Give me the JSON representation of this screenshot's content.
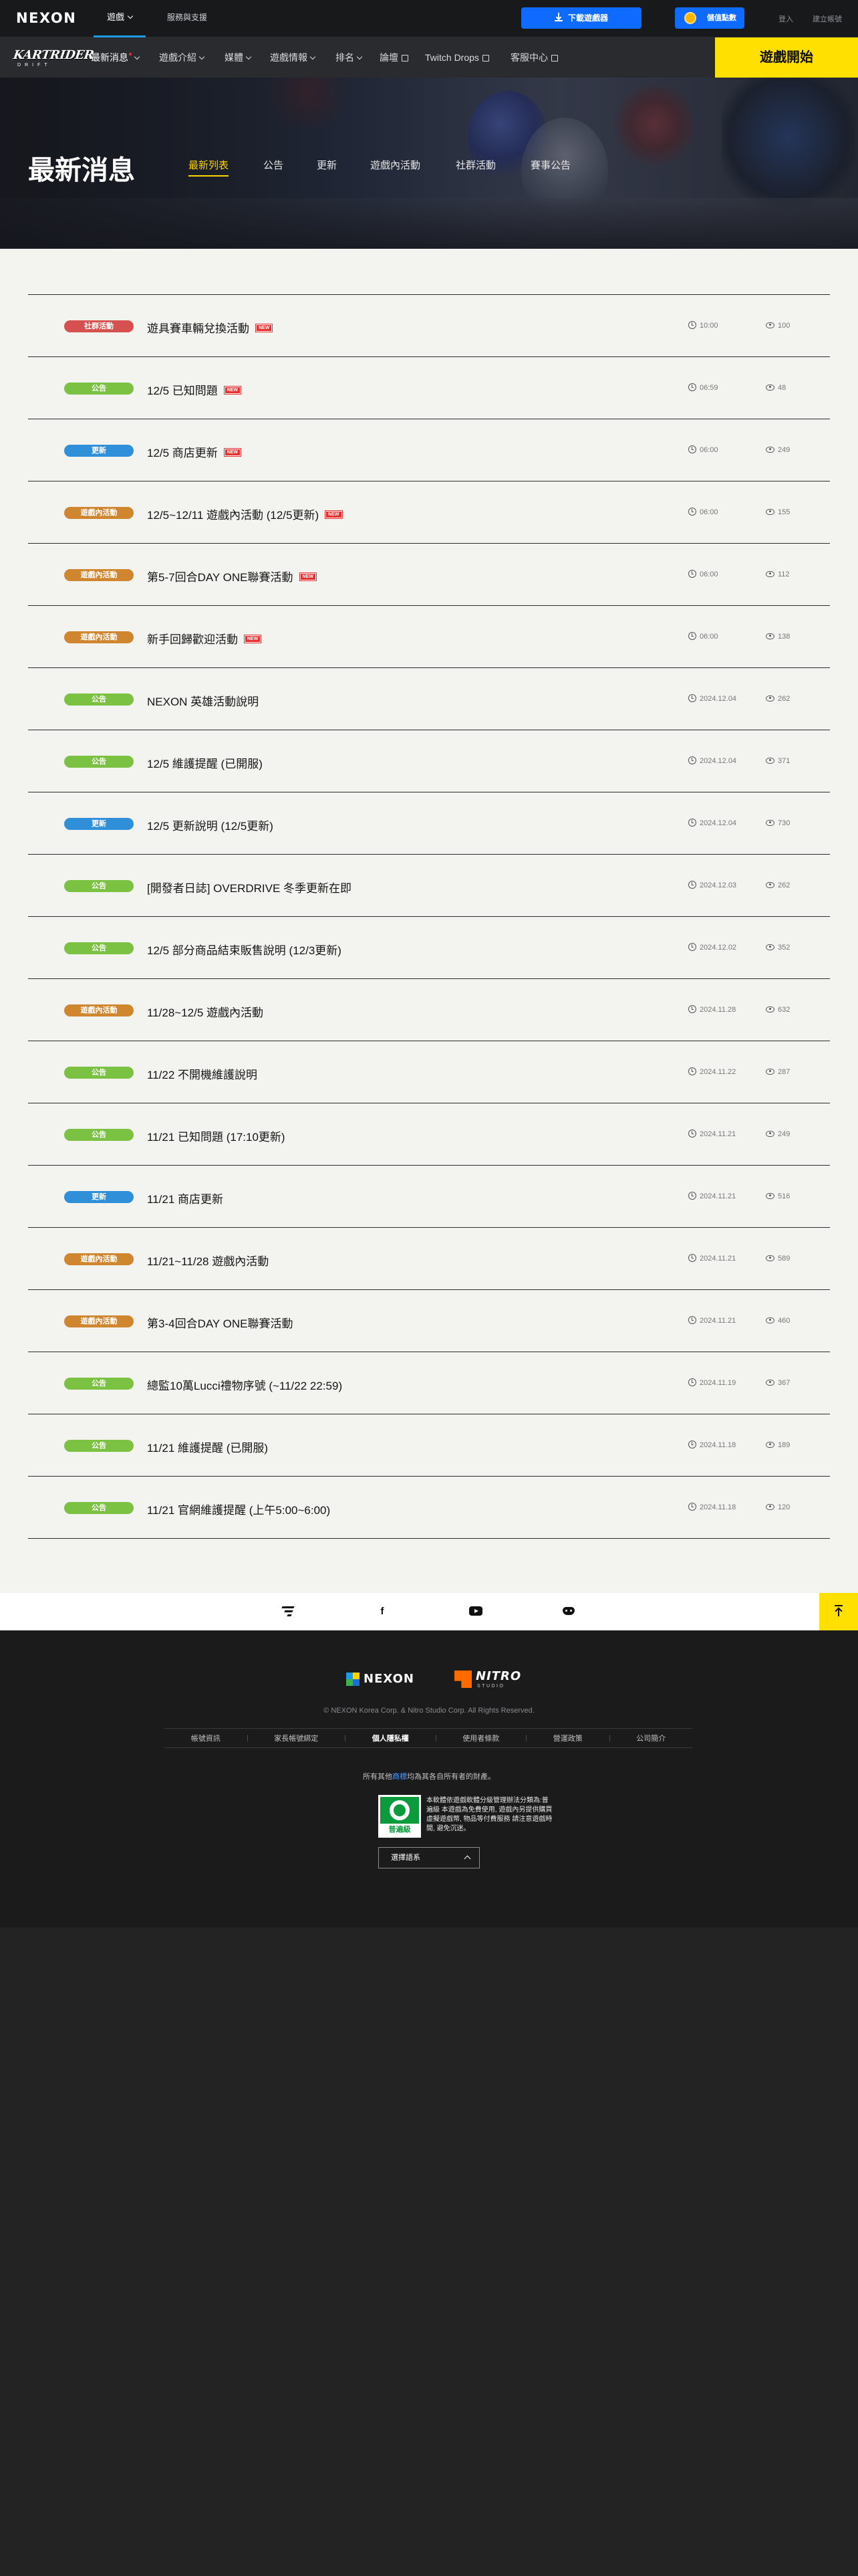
{
  "topbar": {
    "logo": "NEXON",
    "game_label": "遊戲",
    "support_label": "服務與支援",
    "download_label": "下載遊戲器",
    "points_label": "儲值點數",
    "login_label": "登入",
    "signup_label": "建立帳號"
  },
  "gamebar": {
    "logo_text": "KARTRIDER",
    "logo_sub": "DRIFT",
    "nav": [
      "最新消息",
      "遊戲介紹",
      "媒體",
      "遊戲情報",
      "排名",
      "論壇",
      "Twitch Drops",
      "客服中心"
    ],
    "start_label": "遊戲開始"
  },
  "hero": {
    "title": "最新消息",
    "tabs": [
      "最新列表",
      "公告",
      "更新",
      "遊戲內活動",
      "社群活動",
      "賽事公告"
    ],
    "active_tab": "最新列表"
  },
  "news": [
    {
      "category": "社群活動",
      "color": "#d6504f",
      "title": "遊具賽車輛兌換活動",
      "is_new": true,
      "time": "10:00",
      "views": "100"
    },
    {
      "category": "公告",
      "color": "#7bc142",
      "title": "12/5 已知問題",
      "is_new": true,
      "time": "06:59",
      "views": "48"
    },
    {
      "category": "更新",
      "color": "#2f8fd8",
      "title": "12/5 商店更新",
      "is_new": true,
      "time": "06:00",
      "views": "249"
    },
    {
      "category": "遊戲內活動",
      "color": "#d0862f",
      "title": "12/5~12/11 遊戲內活動 (12/5更新)",
      "is_new": true,
      "time": "06:00",
      "views": "155"
    },
    {
      "category": "遊戲內活動",
      "color": "#d0862f",
      "title": "第5-7回合DAY ONE聯賽活動",
      "is_new": true,
      "time": "06:00",
      "views": "112"
    },
    {
      "category": "遊戲內活動",
      "color": "#d0862f",
      "title": "新手回歸歡迎活動",
      "is_new": true,
      "time": "06:00",
      "views": "138"
    },
    {
      "category": "公告",
      "color": "#7bc142",
      "title": "NEXON 英雄活動說明",
      "is_new": false,
      "time": "2024.12.04",
      "views": "262"
    },
    {
      "category": "公告",
      "color": "#7bc142",
      "title": "12/5 維護提醒 (已開服)",
      "is_new": false,
      "time": "2024.12.04",
      "views": "371"
    },
    {
      "category": "更新",
      "color": "#2f8fd8",
      "title": "12/5 更新說明 (12/5更新)",
      "is_new": false,
      "time": "2024.12.04",
      "views": "730"
    },
    {
      "category": "公告",
      "color": "#7bc142",
      "title": "[開發者日誌] OVERDRIVE 冬季更新在即",
      "is_new": false,
      "time": "2024.12.03",
      "views": "262"
    },
    {
      "category": "公告",
      "color": "#7bc142",
      "title": "12/5 部分商品結束販售說明 (12/3更新)",
      "is_new": false,
      "time": "2024.12.02",
      "views": "352"
    },
    {
      "category": "遊戲內活動",
      "color": "#d0862f",
      "title": "11/28~12/5 遊戲內活動",
      "is_new": false,
      "time": "2024.11.28",
      "views": "632"
    },
    {
      "category": "公告",
      "color": "#7bc142",
      "title": "11/22 不開機維護說明",
      "is_new": false,
      "time": "2024.11.22",
      "views": "287"
    },
    {
      "category": "公告",
      "color": "#7bc142",
      "title": "11/21 已知問題 (17:10更新)",
      "is_new": false,
      "time": "2024.11.21",
      "views": "249"
    },
    {
      "category": "更新",
      "color": "#2f8fd8",
      "title": "11/21 商店更新",
      "is_new": false,
      "time": "2024.11.21",
      "views": "516"
    },
    {
      "category": "遊戲內活動",
      "color": "#d0862f",
      "title": "11/21~11/28 遊戲內活動",
      "is_new": false,
      "time": "2024.11.21",
      "views": "589"
    },
    {
      "category": "遊戲內活動",
      "color": "#d0862f",
      "title": "第3-4回合DAY ONE聯賽活動",
      "is_new": false,
      "time": "2024.11.21",
      "views": "460"
    },
    {
      "category": "公告",
      "color": "#7bc142",
      "title": "總監10萬Lucci禮物序號 (~11/22 22:59)",
      "is_new": false,
      "time": "2024.11.19",
      "views": "367"
    },
    {
      "category": "公告",
      "color": "#7bc142",
      "title": "11/21 維護提醒 (已開服)",
      "is_new": false,
      "time": "2024.11.18",
      "views": "189"
    },
    {
      "category": "公告",
      "color": "#7bc142",
      "title": "11/21 官網維護提醒 (上午5:00~6:00)",
      "is_new": false,
      "time": "2024.11.18",
      "views": "120"
    }
  ],
  "new_label": "NEW",
  "social": {
    "icons": [
      "kartrider-icon",
      "facebook-icon",
      "youtube-icon",
      "discord-icon"
    ],
    "facebook_glyph": "f"
  },
  "footer": {
    "nexon_logo": "NEXON",
    "nitro_logo": "NITRO",
    "nitro_sub": "STUDIO",
    "copyright": "© NEXON Korea Corp. & Nitro Studio Corp. All Rights Reserved.",
    "links": [
      "帳號資訊",
      "家長帳號綁定",
      "個人隱私權",
      "使用者條款",
      "營運政策",
      "公司簡介"
    ],
    "strong_link": "個人隱私權",
    "note_pre": "所有其他",
    "note_link": "商標",
    "note_post": "均為其各自所有者的財產。",
    "rating_label": "普遍級",
    "rating_text": "本軟體依遊戲軟體分級管理辦法分類為:普遍級 本遊戲為免費使用, 遊戲內另提供購買虛擬遊戲幣, 物品等付費服務 請注意遊戲時間, 避免沉迷。",
    "language_label": "選擇語系"
  },
  "colors": {
    "accent_yellow": "#ffe000",
    "download_blue": "#0f6bff",
    "tag_community": "#d6504f",
    "tag_notice": "#7bc142",
    "tag_update": "#2f8fd8",
    "tag_ingame": "#d0862f"
  }
}
